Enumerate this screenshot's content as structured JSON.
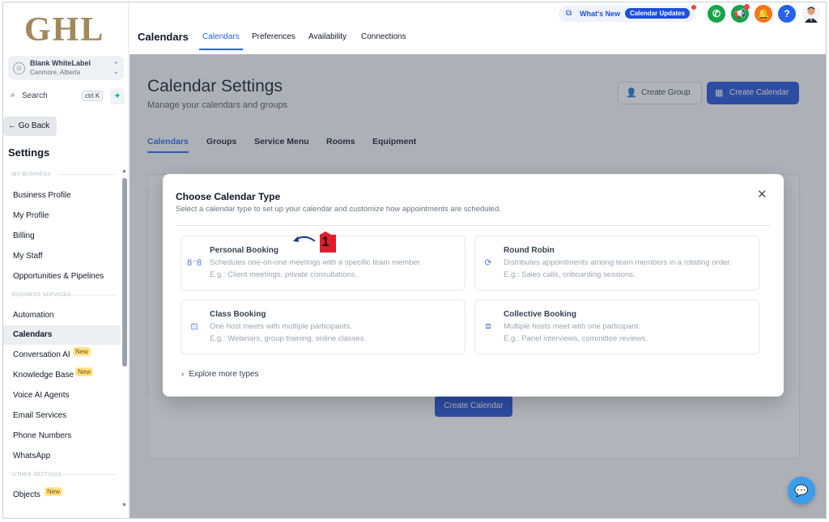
{
  "sidebar": {
    "logo": "GHL",
    "account_name": "Blank WhiteLabel",
    "account_location": "Canmore, Alberta",
    "search_label": "Search",
    "search_shortcut": "ctrl K",
    "go_back": "Go Back",
    "settings_title": "Settings",
    "sections": {
      "my_business": "MY BUSINESS",
      "business_services": "BUSINESS SERVICES",
      "other_settings": "OTHER SETTINGS"
    },
    "items": [
      {
        "label": "Business Profile"
      },
      {
        "label": "My Profile"
      },
      {
        "label": "Billing"
      },
      {
        "label": "My Staff"
      },
      {
        "label": "Opportunities & Pipelines"
      },
      {
        "label": "Automation"
      },
      {
        "label": "Calendars"
      },
      {
        "label": "Conversation AI",
        "badge": "New"
      },
      {
        "label": "Knowledge Base",
        "badge": "New"
      },
      {
        "label": "Voice AI Agents"
      },
      {
        "label": "Email Services"
      },
      {
        "label": "Phone Numbers"
      },
      {
        "label": "WhatsApp"
      },
      {
        "label": "Objects",
        "badge": "New"
      }
    ]
  },
  "topbar": {
    "title": "Calendars",
    "tabs": [
      "Calendars",
      "Preferences",
      "Availability",
      "Connections"
    ],
    "whats_new": "What's New",
    "updates_pill": "Calendar Updates"
  },
  "main": {
    "title": "Calendar Settings",
    "subtitle": "Manage your calendars and groups",
    "create_group": "Create Group",
    "create_calendar": "Create Calendar",
    "tabs": [
      "Calendars",
      "Groups",
      "Service Menu",
      "Rooms",
      "Equipment"
    ],
    "empty_create_button": "Create Calendar"
  },
  "modal": {
    "title": "Choose Calendar Type",
    "subtitle": "Select a calendar type to set up your calendar and customize how appointments are scheduled.",
    "options": [
      {
        "title": "Personal Booking",
        "desc": "Schedules one-on-one meetings with a specific team member.",
        "example": "E.g.: Client meetings, private consultations.",
        "icon": "personal-booking-icon"
      },
      {
        "title": "Round Robin",
        "desc": "Distributes appointments among team members in a rotating order.",
        "example": "E.g.: Sales calls, onboarding sessions.",
        "icon": "round-robin-icon"
      },
      {
        "title": "Class Booking",
        "desc": "One host meets with multiple participants.",
        "example": "E.g.: Webinars, group training, online classes.",
        "icon": "class-booking-icon"
      },
      {
        "title": "Collective Booking",
        "desc": "Multiple hosts meet with one participant.",
        "example": "E.g.: Panel interviews, committee reviews.",
        "icon": "collective-booking-icon"
      }
    ],
    "explore": "Explore more types"
  },
  "annotation": {
    "step": "1",
    "color": "#e11d2e"
  },
  "colors": {
    "accent": "#2563eb",
    "primary_button": "#1d4ed8",
    "logo_gold": "#a08a5c"
  }
}
